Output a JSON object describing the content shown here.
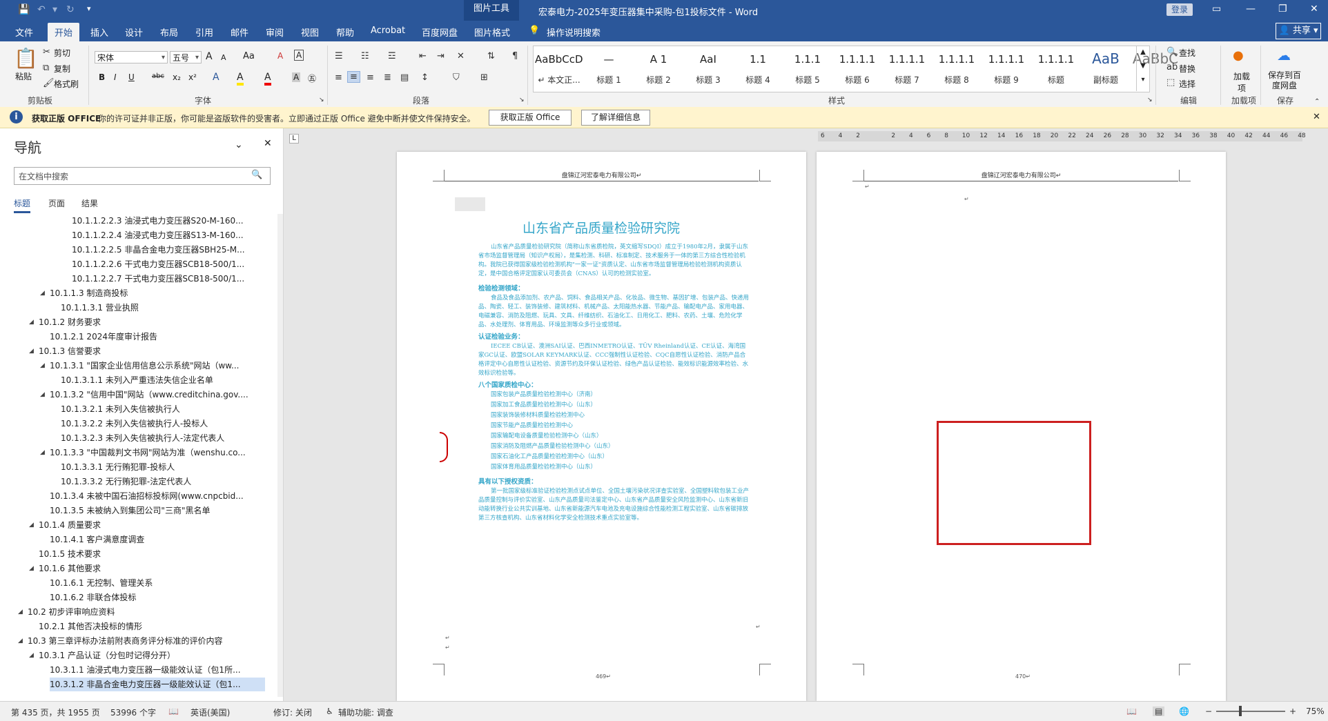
{
  "window": {
    "doc_title": "宏泰电力-2025年变压器集中采购-包1投标文件",
    "app_name": "Word",
    "title_separator": " - ",
    "context_tab_header": "图片工具",
    "login_label": "登录"
  },
  "tabs": [
    "文件",
    "开始",
    "插入",
    "设计",
    "布局",
    "引用",
    "邮件",
    "审阅",
    "视图",
    "帮助",
    "Acrobat",
    "百度网盘",
    "图片格式"
  ],
  "active_tab": "开始",
  "tell_me": "操作说明搜索",
  "share_label": "共享",
  "ribbon": {
    "clipboard": {
      "paste": "粘贴",
      "cut": "剪切",
      "copy": "复制",
      "format_painter": "格式刷",
      "label": "剪贴板"
    },
    "font": {
      "name": "宋体",
      "size": "五号",
      "label": "字体",
      "bold": "B",
      "italic": "I",
      "underline": "U",
      "strike": "abc",
      "sub": "x₂",
      "sup": "x²",
      "grow": "A",
      "shrink": "A",
      "case": "Aa",
      "clear": "A",
      "highlight": "A",
      "color": "A"
    },
    "paragraph": {
      "label": "段落"
    },
    "styles": {
      "label": "样式",
      "items": [
        {
          "preview": "AaBbCcDdl",
          "name": "↵ 本文正..."
        },
        {
          "preview": "—",
          "name": "标题 1"
        },
        {
          "preview": "A 1",
          "name": "标题 2"
        },
        {
          "preview": "AaI",
          "name": "标题 3"
        },
        {
          "preview": "1.1",
          "name": "标题 4"
        },
        {
          "preview": "1.1.1",
          "name": "标题 5"
        },
        {
          "preview": "1.1.1.1",
          "name": "标题 6"
        },
        {
          "preview": "1.1.1.1",
          "name": "标题 7"
        },
        {
          "preview": "1.1.1.1",
          "name": "标题 8"
        },
        {
          "preview": "1.1.1.1",
          "name": "标题 9"
        },
        {
          "preview": "1.1.1.1",
          "name": "标题"
        },
        {
          "preview": "AaB",
          "name": "副标题"
        },
        {
          "preview": "AaBbC",
          "name": ""
        }
      ]
    },
    "editing": {
      "find": "查找",
      "replace": "替换",
      "select": "选择",
      "label": "编辑"
    },
    "addins": {
      "btn": "加载项",
      "label": "加载项"
    },
    "save": {
      "btn": "保存到百度网盘",
      "label": "保存"
    }
  },
  "message_bar": {
    "title": "获取正版 OFFICE",
    "body": "你的许可证并非正版，你可能是盗版软件的受害者。立即通过正版 Office 避免中断并使文件保持安全。",
    "btn1": "获取正版 Office",
    "btn2": "了解详细信息"
  },
  "nav": {
    "title": "导航",
    "search_placeholder": "在文档中搜索",
    "tabs": [
      "标题",
      "页面",
      "结果"
    ],
    "items": [
      {
        "level": 7,
        "text": "10.1.1.2.2.3 油浸式电力变压器S20-M-160...",
        "caret": false
      },
      {
        "level": 7,
        "text": "10.1.1.2.2.4 油浸式电力变压器S13-M-160...",
        "caret": false
      },
      {
        "level": 7,
        "text": "10.1.1.2.2.5 非晶合金电力变压器SBH25-M...",
        "caret": false
      },
      {
        "level": 7,
        "text": "10.1.1.2.2.6 干式电力变压器SCB18-500/1...",
        "caret": false
      },
      {
        "level": 7,
        "text": "10.1.1.2.2.7 干式电力变压器SCB18-500/1...",
        "caret": false
      },
      {
        "level": 5,
        "text": "10.1.1.3 制造商投标",
        "caret": true
      },
      {
        "level": 6,
        "text": "10.1.1.3.1 营业执照",
        "caret": false
      },
      {
        "level": 4,
        "text": "10.1.2 财务要求",
        "caret": true
      },
      {
        "level": 5,
        "text": "10.1.2.1 2024年度审计报告",
        "caret": false
      },
      {
        "level": 4,
        "text": "10.1.3 信誉要求",
        "caret": true
      },
      {
        "level": 5,
        "text": "10.1.3.1 \"国家企业信用信息公示系统\"网站（ww...",
        "caret": true
      },
      {
        "level": 6,
        "text": "10.1.3.1.1 未列入严重违法失信企业名单",
        "caret": false
      },
      {
        "level": 5,
        "text": "10.1.3.2 \"信用中国\"网站（www.creditchina.gov....",
        "caret": true
      },
      {
        "level": 6,
        "text": "10.1.3.2.1 未列入失信被执行人",
        "caret": false
      },
      {
        "level": 6,
        "text": "10.1.3.2.2 未列入失信被执行人-投标人",
        "caret": false
      },
      {
        "level": 6,
        "text": "10.1.3.2.3 未列入失信被执行人-法定代表人",
        "caret": false
      },
      {
        "level": 5,
        "text": "10.1.3.3 \"中国裁判文书网\"网站为准（wenshu.co...",
        "caret": true
      },
      {
        "level": 6,
        "text": "10.1.3.3.1 无行贿犯罪-投标人",
        "caret": false
      },
      {
        "level": 6,
        "text": "10.1.3.3.2 无行贿犯罪-法定代表人",
        "caret": false
      },
      {
        "level": 5,
        "text": "10.1.3.4 未被中国石油招标投标网(www.cnpcbid...",
        "caret": false
      },
      {
        "level": 5,
        "text": "10.1.3.5 未被纳入到集团公司\"三商\"黑名单",
        "caret": false
      },
      {
        "level": 4,
        "text": "10.1.4 质量要求",
        "caret": true
      },
      {
        "level": 5,
        "text": "10.1.4.1 客户满意度调查",
        "caret": false
      },
      {
        "level": 4,
        "text": "10.1.5 技术要求",
        "caret": false
      },
      {
        "level": 4,
        "text": "10.1.6 其他要求",
        "caret": true
      },
      {
        "level": 5,
        "text": "10.1.6.1 无控制、管理关系",
        "caret": false
      },
      {
        "level": 5,
        "text": "10.1.6.2 非联合体投标",
        "caret": false
      },
      {
        "level": 3,
        "text": "10.2 初步评审响应资料",
        "caret": true
      },
      {
        "level": 4,
        "text": "10.2.1 其他否决投标的情形",
        "caret": false
      },
      {
        "level": 3,
        "text": "10.3 第三章评标办法前附表商务评分标准的评价内容",
        "caret": true
      },
      {
        "level": 4,
        "text": "10.3.1 产品认证（分包时记得分开）",
        "caret": true
      },
      {
        "level": 5,
        "text": "10.3.1.1 油浸式电力变压器一级能效认证（包1所...",
        "caret": false
      },
      {
        "level": 5,
        "text": "10.3.1.2 非晶合金电力变压器一级能效认证（包1...",
        "caret": false,
        "selected": true
      }
    ]
  },
  "pages": {
    "left": {
      "header": "盘锦辽河宏泰电力有限公司↵",
      "title": "山东省产品质量检验研究院",
      "intro": "山东省产品质量检验研究院（简称山东省质检院，英文缩写SDQI）成立于1980年2月，隶属于山东省市场监督管理局（知识产权局），是集检测、科研、标准制定、技术服务于一体的第三方综合性检验机构。我院已获得国家级检验检测机构\"一家一证\"资质认定、山东省市场监督管理局检验检测机构资质认定，是中国合格评定国家认可委员会（CNAS）认可的检测实验室。",
      "s1_title": "检验检测领域：",
      "s1_body": "食品及食品添加剂、农产品、饲料、食品相关产品、化妆品、微生物、基因扩增、包装产品、快递用品、陶瓷、轻工、装饰装修、建筑材料、机械产品、太阳能热水器、节能产品、输配电产品、家用电器、电磁兼容、消防及阻燃、玩具、文具、纤维纺织、石油化工、日用化工、肥料、农药、土壤、危险化学品、水处理剂、体育用品、环境监测等众多行业或领域。",
      "s2_title": "认证检验业务：",
      "s2_body": "IECEE CB认证、澳洲SAI认证、巴西INMETRO认证、TÜV Rheinland认证、CE认证、海湾国家GC认证、欧盟SOLAR KEYMARK认证、CCC强制性认证检验、CQC自愿性认证检验、消防产品合格评定中心自愿性认证检验、资源节约及环保认证检验、绿色产品认证检验、能效标识能源效率检验、水效标识检验等。",
      "s3_title": "八个国家质检中心：",
      "centers": [
        "国家包装产品质量检验检测中心（济南）",
        "国家加工食品质量检验检测中心（山东）",
        "国家装饰装修材料质量检验检测中心",
        "国家节能产品质量检验检测中心",
        "国家输配电设备质量检验检测中心（山东）",
        "国家消防及阻燃产品质量检验检测中心（山东）",
        "国家石油化工产品质量检验检测中心（山东）",
        "国家体育用品质量检验检测中心（山东）"
      ],
      "s4_title": "具有以下授权资质：",
      "s4_body": "第一批国家级标准验证检验检测点试点单位、全国土壤污染状况详查实验室、全国塑料软包装工业产品质量控制与评价实验室、山东产品质量司法鉴定中心、山东省产品质量安全风险监测中心、山东省新旧动能转换行业公共实训基地、山东省新能源汽车电池及充电设施综合性能检测工程实验室、山东省碳排放第三方核查机构、山东省材料化学安全检测技术重点实验室等。",
      "page_num": "469↵"
    },
    "right": {
      "header": "盘锦辽河宏泰电力有限公司↵",
      "page_num": "470↵"
    }
  },
  "ruler_ticks": [
    "6",
    "4",
    "2",
    "",
    "2",
    "4",
    "6",
    "8",
    "10",
    "12",
    "14",
    "16",
    "18",
    "20",
    "22",
    "24",
    "26",
    "28",
    "30",
    "32",
    "34",
    "36",
    "38",
    "40",
    "42",
    "44",
    "46",
    "48"
  ],
  "status": {
    "page": "第 435 页，共 1955 页",
    "words": "53996 个字",
    "lang": "英语(美国)",
    "track": "修订: 关闭",
    "accessibility": "辅助功能: 调查",
    "zoom": "75%"
  },
  "colors": {
    "brand": "#2b579a",
    "doc_text": "#35a6c9",
    "selection_box": "#cc1f1f",
    "message_bg": "#fff4ce"
  }
}
